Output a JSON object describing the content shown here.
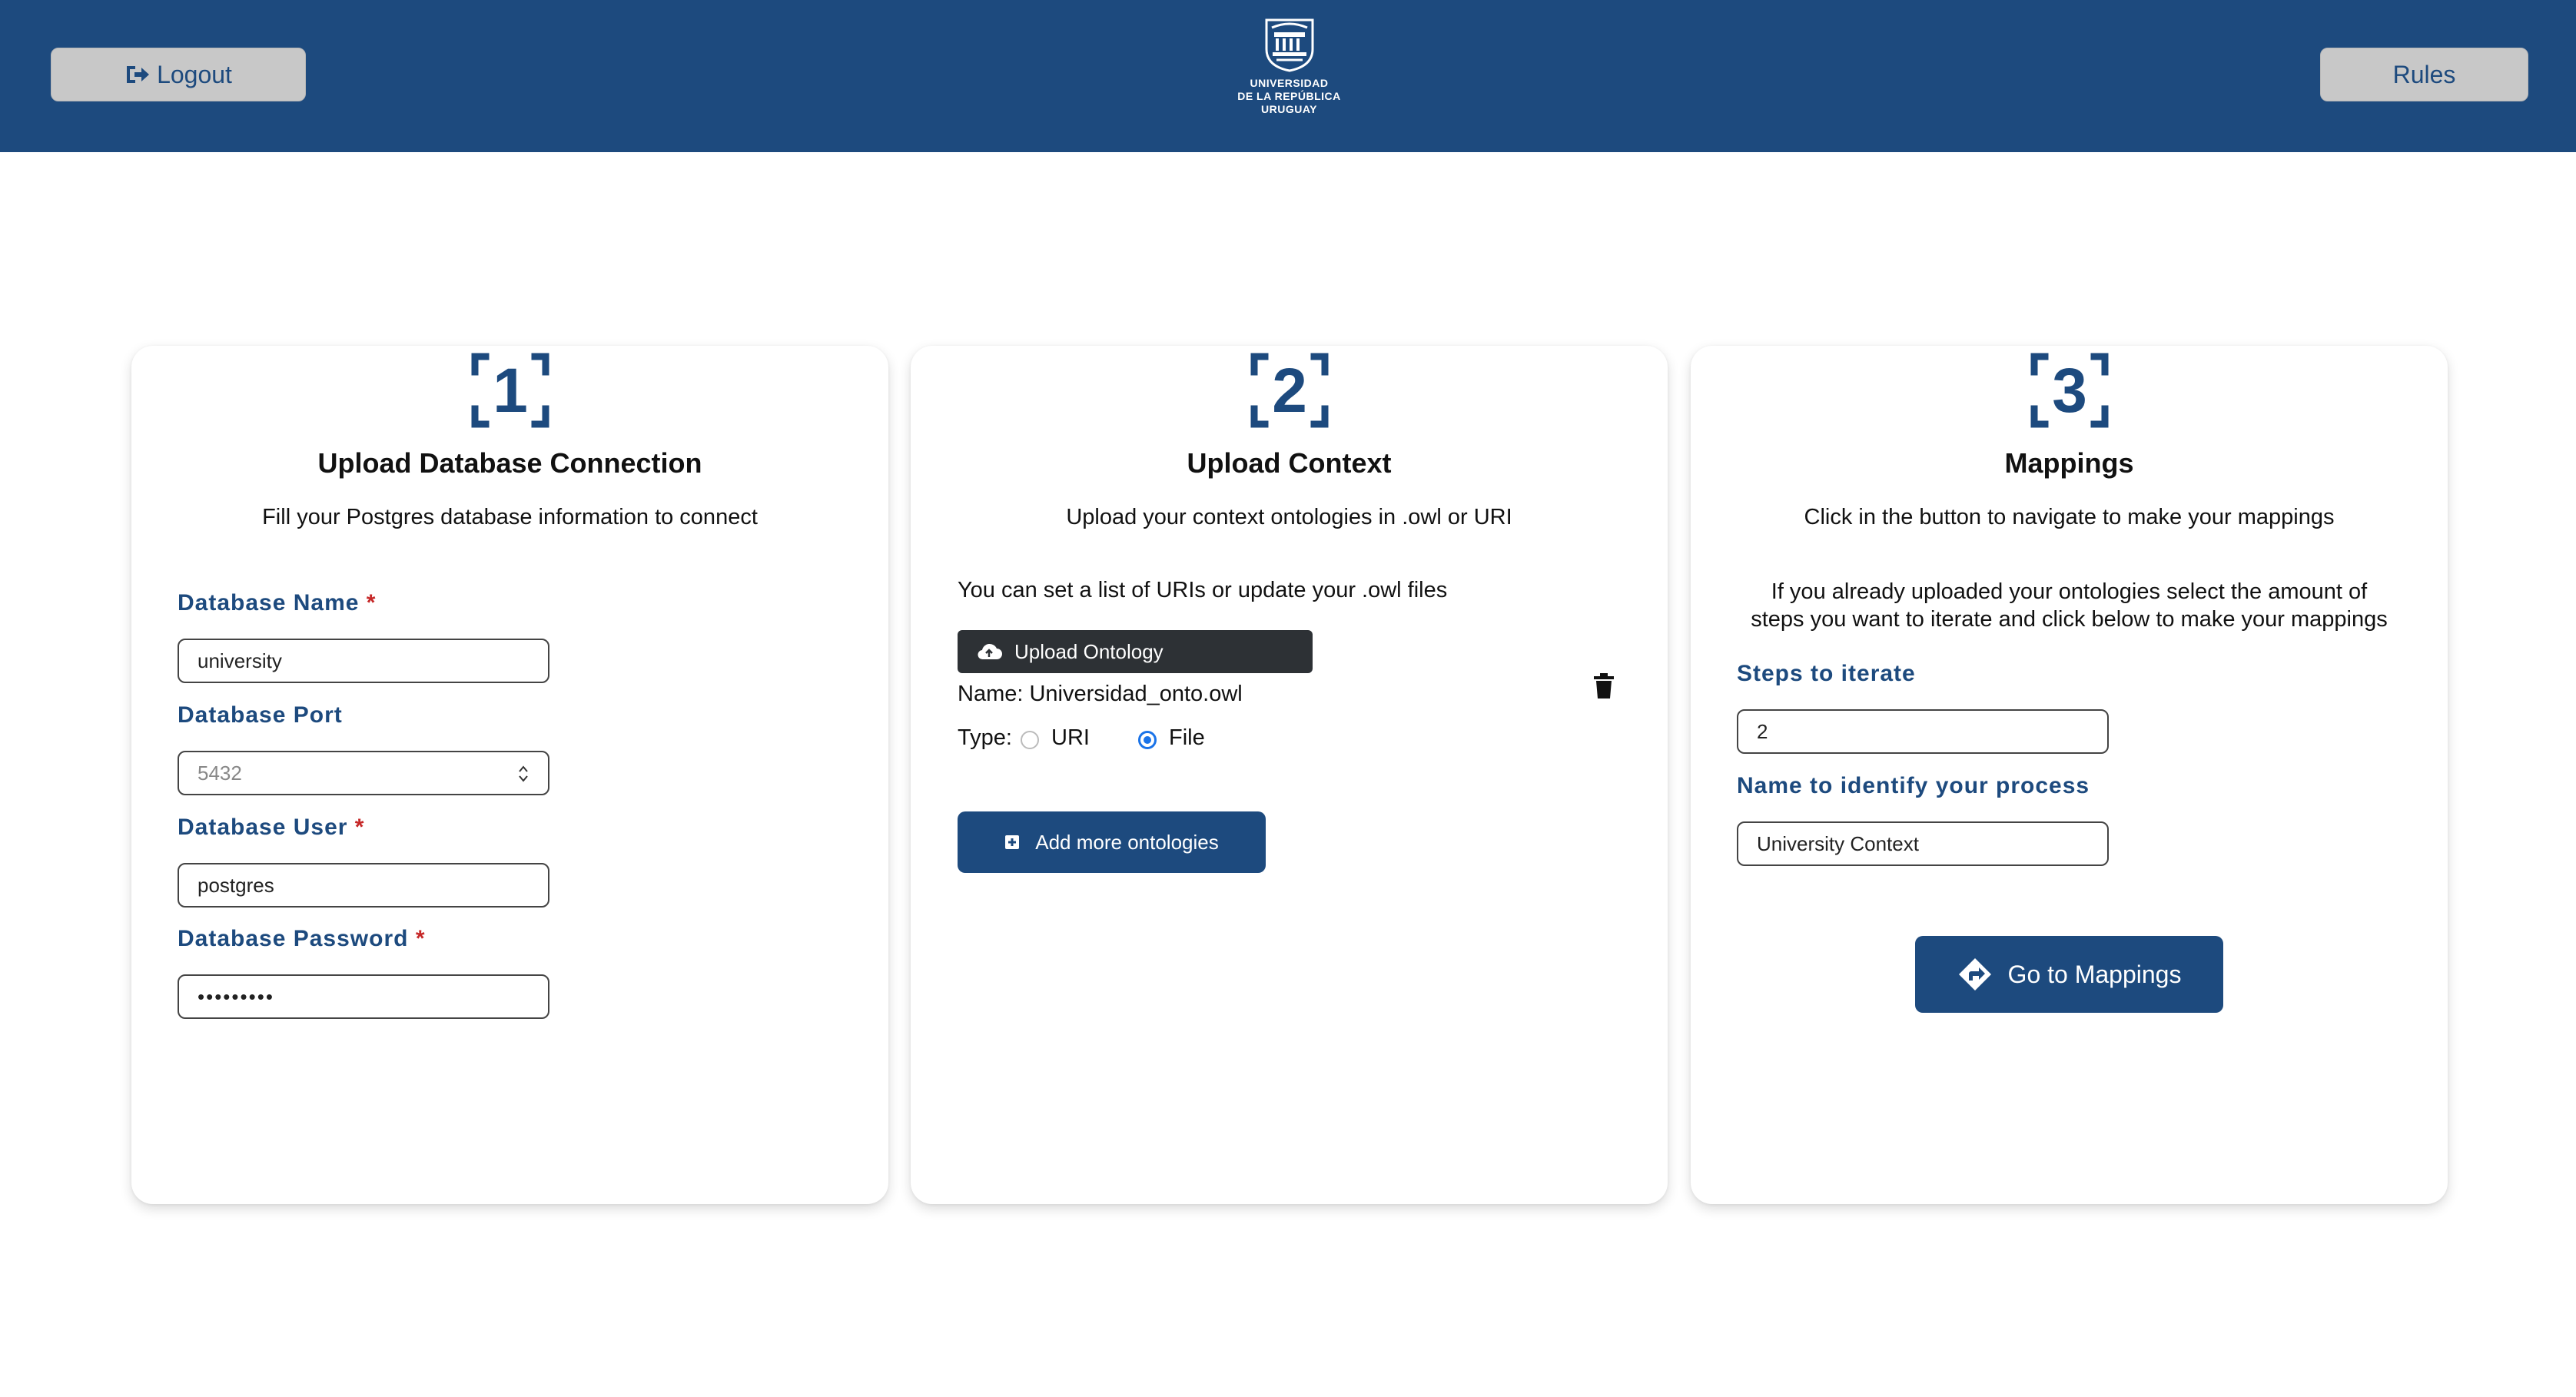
{
  "header": {
    "logout_label": "Logout",
    "rules_label": "Rules",
    "logo_lines": [
      "UNIVERSIDAD",
      "DE LA REPÚBLICA",
      "URUGUAY"
    ]
  },
  "card1": {
    "step": "1",
    "title": "Upload Database Connection",
    "subtitle": "Fill your Postgres database information to connect",
    "fields": [
      {
        "label": "Database Name",
        "required": "*",
        "value": "university"
      },
      {
        "label": "Database Port",
        "required": "",
        "value": "5432"
      },
      {
        "label": "Database User",
        "required": "*",
        "value": "postgres"
      },
      {
        "label": "Database Password",
        "required": "*",
        "value": "•••••••••"
      }
    ]
  },
  "card2": {
    "step": "2",
    "title": "Upload Context",
    "subtitle": "Upload your context ontologies in .owl or URI",
    "hint": "You can set a list of URIs or update your .owl files",
    "upload_label": "Upload Ontology",
    "file_name": "Name: Universidad_onto.owl",
    "type_label": "Type:",
    "type_options": [
      "URI",
      "File"
    ],
    "type_selected": "File",
    "add_more_label": "Add more ontologies"
  },
  "card3": {
    "step": "3",
    "title": "Mappings",
    "subtitle": "Click in the button to navigate to make your mappings",
    "paragraph_line1": "If you already uploaded your ontologies select the amount of",
    "paragraph_line2": "steps you want to iterate and click below to make your mappings",
    "steps_label": "Steps to iterate",
    "steps_value": "2",
    "process_label": "Name to identify your process",
    "process_value": "University Context",
    "goto_label": "Go to Mappings"
  },
  "colors": {
    "brand": "#1d4a7e",
    "header_button": "#c8c8c8",
    "upload_button": "#2d3135",
    "required": "#c62828",
    "radio_active": "#1a73e8"
  },
  "icons": [
    "sign-out-icon",
    "university-seal-icon",
    "step-1-icon",
    "step-2-icon",
    "step-3-icon",
    "cloud-upload-icon",
    "trash-icon",
    "plus-square-icon",
    "directions-icon"
  ]
}
